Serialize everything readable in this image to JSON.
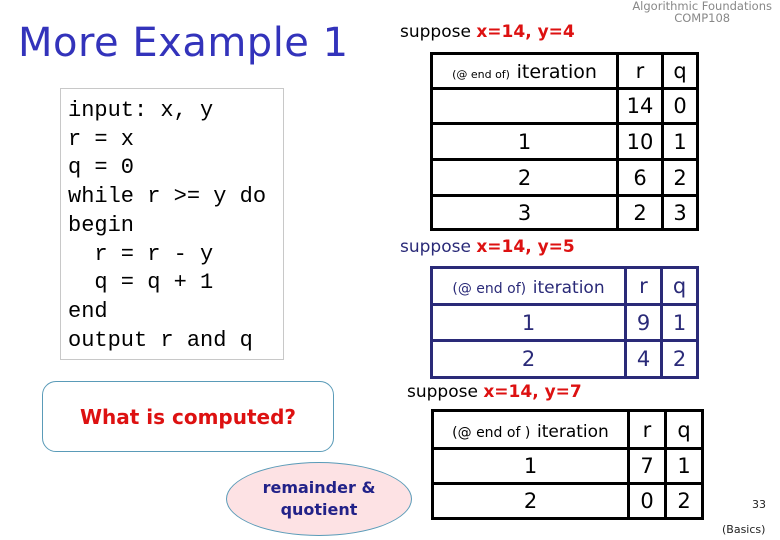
{
  "header": {
    "course_line1": "Algorithmic Foundations",
    "course_line2": "COMP108"
  },
  "title": "More Example 1",
  "pseudocode": [
    "input: x, y",
    "r = x",
    "q = 0",
    "while r >= y do",
    "begin",
    "  r = r - y",
    "  q = q + 1",
    "end",
    "output r and q"
  ],
  "question": "What is computed?",
  "answer_line1": "remainder &",
  "answer_line2": "quotient",
  "colors": {
    "title": "#3333bb",
    "highlight": "#dd1111",
    "navy": "#2a2a78",
    "ellipse_fill": "#fde2e4",
    "callout_border": "#5a9bb8"
  },
  "traces": [
    {
      "suppose_label": "suppose",
      "suppose_values": "x=14, y=4",
      "header": {
        "prefix": "(@ end of)",
        "iteration": "iteration",
        "r": "r",
        "q": "q"
      },
      "rows": [
        {
          "iteration": "",
          "r": "14",
          "q": "0"
        },
        {
          "iteration": "1",
          "r": "10",
          "q": "1"
        },
        {
          "iteration": "2",
          "r": "6",
          "q": "2"
        },
        {
          "iteration": "3",
          "r": "2",
          "q": "3"
        }
      ]
    },
    {
      "suppose_label": "suppose",
      "suppose_values": "x=14, y=5",
      "header": {
        "prefix": "(@ end of)",
        "iteration": "iteration",
        "r": "r",
        "q": "q"
      },
      "rows": [
        {
          "iteration": "1",
          "r": "9",
          "q": "1"
        },
        {
          "iteration": "2",
          "r": "4",
          "q": "2"
        }
      ]
    },
    {
      "suppose_label": "suppose",
      "suppose_values": "x=14, y=7",
      "header": {
        "prefix": "(@ end of )",
        "iteration": "iteration",
        "r": "r",
        "q": "q"
      },
      "rows": [
        {
          "iteration": "1",
          "r": "7",
          "q": "1"
        },
        {
          "iteration": "2",
          "r": "0",
          "q": "2"
        }
      ]
    }
  ],
  "footer": {
    "page_number": "33",
    "section": "(Basics)"
  }
}
